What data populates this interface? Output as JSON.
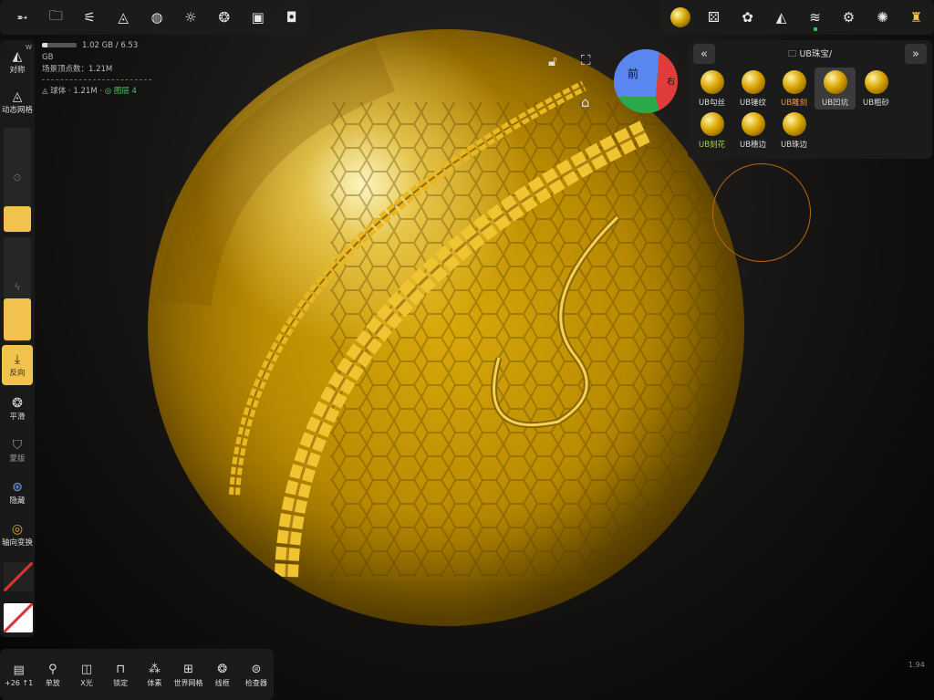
{
  "top_toolbar_left": {
    "icons": [
      "swipe-icon",
      "folder-icon",
      "share-nodes-icon",
      "sculpt-tool-icon",
      "globe-icon",
      "sun-icon",
      "material-wheel-icon",
      "image-icon",
      "video-camera-icon"
    ],
    "glyphs": [
      "➵",
      "🗀",
      "⚟",
      "◬",
      "◍",
      "☼",
      "❂",
      "▣",
      "◘"
    ]
  },
  "top_toolbar_right": {
    "icons": [
      "material-ball-icon",
      "dice-icon",
      "palette-icon",
      "symmetry-icon",
      "layers-icon",
      "settings-icon",
      "bug-icon",
      "stamp-icon"
    ],
    "glyphs": [
      "",
      "⚄",
      "✿",
      "◭",
      "≋",
      "⚙",
      "✺",
      "♜"
    ]
  },
  "info": {
    "memory": "1.02 GB / 6.53 GB",
    "memory_fraction": 0.16,
    "scene_vertices": "场景顶点数：1.21M",
    "mesh": "球体 · 1.21M ·",
    "layer": "图层 4"
  },
  "left_tools": {
    "symmetry": "对称",
    "dynamic_mesh": "动态网格",
    "w_label": "W",
    "invert": "反向",
    "smooth": "平滑",
    "mask": "蒙版",
    "hide": "隐藏",
    "axis_transform": "轴向变换"
  },
  "material_panel": {
    "folder": "UB珠宝/",
    "items": [
      {
        "label": "UB勾丝"
      },
      {
        "label": "UB锤纹"
      },
      {
        "label": "UB雕刻"
      },
      {
        "label": "UB凹坑"
      },
      {
        "label": "UB粗砂"
      },
      {
        "label": "UB刻花"
      },
      {
        "label": "UB穗边"
      },
      {
        "label": "UB珠边"
      }
    ]
  },
  "nav_cube": {
    "front": "前",
    "right": "右"
  },
  "bottom_toolbar": {
    "counter": "+26 ↑1",
    "solo": "单放",
    "xray": "X光",
    "lock": "锁定",
    "voxel": "体素",
    "world_grid": "世界网格",
    "wireframe": "线框",
    "inspector": "检查器"
  },
  "version": "1.94",
  "colors": {
    "accent": "#f2c24e",
    "gold": "#d4a400",
    "orange_label": "#f0973b",
    "green_label": "#a8d44a"
  }
}
